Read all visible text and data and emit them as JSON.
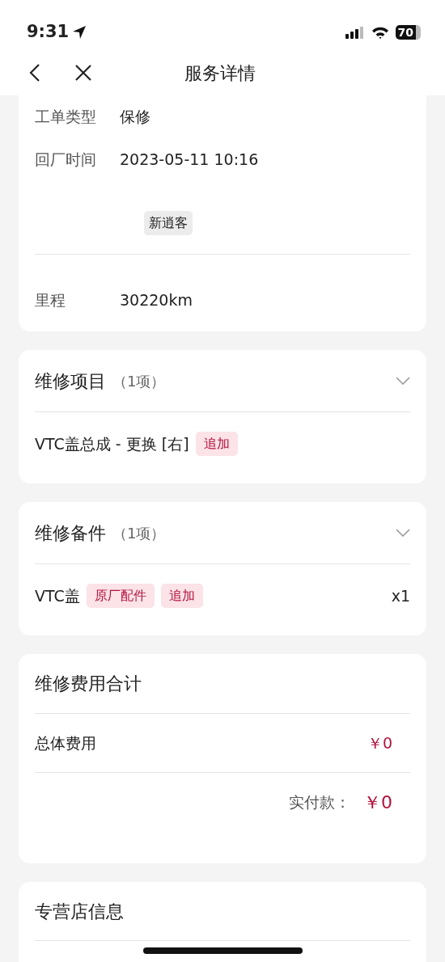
{
  "status_bar": {
    "time": "9:31",
    "battery": "70"
  },
  "nav": {
    "title": "服务详情"
  },
  "info_rows": [
    {
      "label": "工单类型",
      "value": "保修"
    },
    {
      "label": "回厂时间",
      "value": "2023-05-11 10:16"
    },
    {
      "tag": "新逍客"
    },
    {
      "label": "里程",
      "value": "30220km"
    }
  ],
  "sections": [
    {
      "title": "维修项目",
      "count": "（1项）",
      "expanded": true,
      "items": [
        {
          "name": "VTC盖总成 - 更换 [右]",
          "tags": [
            "追加"
          ]
        }
      ]
    },
    {
      "title": "维修备件",
      "count": "（1项）",
      "expanded": true,
      "items": [
        {
          "name": "VTC盖",
          "tags": [
            "原厂配件",
            "追加"
          ],
          "qty": "x1"
        }
      ]
    }
  ],
  "costs": {
    "title": "维修费用合计",
    "total_label": "总体费用",
    "total_value": "￥0",
    "paid_label": "实付款：",
    "paid_value": "￥0"
  },
  "store": {
    "title": "专营店信息"
  }
}
